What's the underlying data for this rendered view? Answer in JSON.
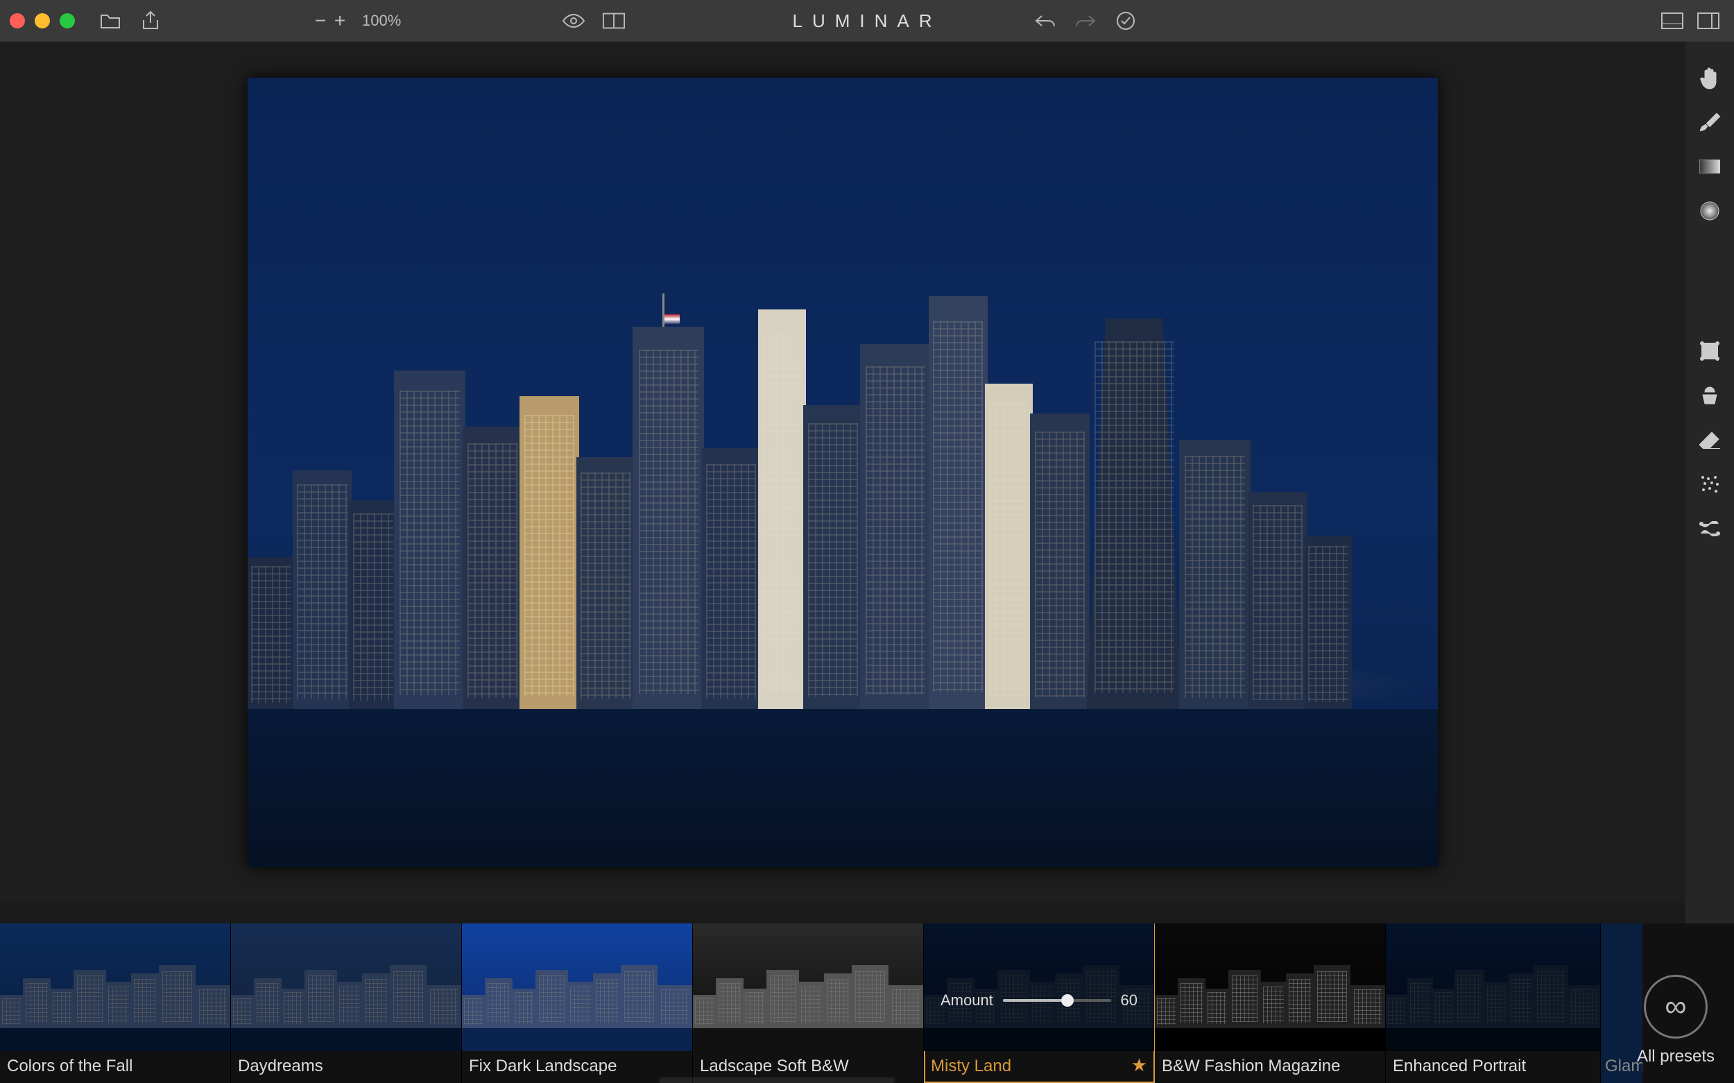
{
  "app": {
    "title": "LUMINAR"
  },
  "toolbar": {
    "zoom_level": "100%",
    "icons": {
      "open": "folder-icon",
      "share": "share-icon",
      "zoom_out": "−",
      "zoom_in": "+",
      "preview": "eye-icon",
      "compare": "compare-icon",
      "undo": "undo-icon",
      "redo": "redo-icon",
      "status": "status-check-icon",
      "panel1": "panel-layout-icon",
      "panel2": "sidebar-toggle-icon"
    }
  },
  "right_tools": {
    "group1": [
      "hand-icon",
      "brush-icon",
      "gradient-icon",
      "radial-icon"
    ],
    "group2": [
      "crop-icon",
      "clone-icon",
      "erase-icon",
      "denoise-icon",
      "transform-icon"
    ]
  },
  "presets": {
    "amount_label": "Amount",
    "amount_value": "60",
    "all_label": "All presets",
    "items": [
      {
        "label": "Colors of the Fall",
        "style": "normal"
      },
      {
        "label": "Daydreams",
        "style": "normal"
      },
      {
        "label": "Fix Dark Landscape",
        "style": "bright"
      },
      {
        "label": "Ladscape Soft B&W",
        "style": "bw"
      },
      {
        "label": "Misty Land",
        "style": "dark",
        "selected": true,
        "favorite": true,
        "show_amount": true
      },
      {
        "label": "B&W Fashion Magazine",
        "style": "bw"
      },
      {
        "label": "Enhanced Portrait",
        "style": "dark"
      }
    ],
    "partial_next": "Glamour"
  },
  "colors": {
    "accent": "#d99a3b"
  }
}
